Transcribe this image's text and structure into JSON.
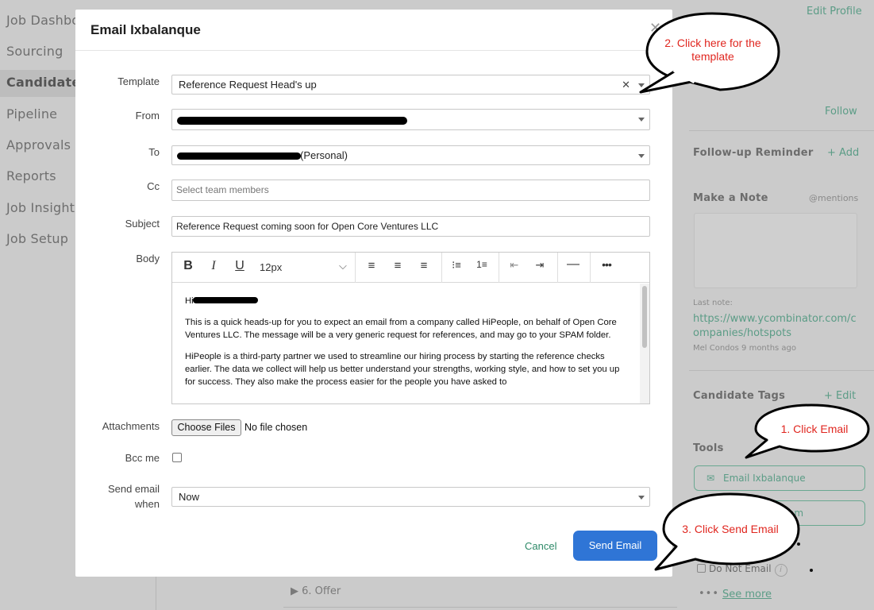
{
  "nav": {
    "items": [
      "Job Dashbo",
      "Sourcing",
      "Candidates",
      "Pipeline",
      "Approvals",
      "Reports",
      "Job Insights",
      "Job Setup"
    ]
  },
  "background": {
    "offer_label": "6. Offer"
  },
  "right_panel": {
    "edit_profile": "Edit Profile",
    "follow": "Follow",
    "followup_reminder": "Follow-up Reminder",
    "add": "+ Add",
    "make_note": "Make a Note",
    "mentions": "@mentions",
    "last_note_label": "Last note:",
    "last_note_link_line1": "https://www.ycombinator.com/c",
    "last_note_link_line2": "ompanies/hotspots",
    "last_note_meta": "Mel Condos 9 months ago",
    "candidate_tags": "Candidate Tags",
    "edit": "+ Edit",
    "tools": "Tools",
    "email_button": "Email Ixbalanque",
    "team_button_fragment": "am",
    "do_not_email": "Do Not Email",
    "see_more": "See more"
  },
  "modal": {
    "title": "Email Ixbalanque",
    "labels": {
      "template": "Template",
      "from": "From",
      "to": "To",
      "cc": "Cc",
      "subject": "Subject",
      "body": "Body",
      "attachments": "Attachments",
      "bcc": "Bcc me",
      "send_when_1": "Send email",
      "send_when_2": "when"
    },
    "template_value": "Reference Request Head's up",
    "to_value_suffix": "(Personal)",
    "cc_placeholder": "Select team members",
    "subject_value": "Reference Request coming soon for Open Core Ventures LLC",
    "font_size": "12px",
    "body": {
      "greeting": "Hi",
      "p1": "This is a quick heads-up for you to expect an email from a company called HiPeople, on behalf of Open Core Ventures LLC. The message will be a very generic request for references, and may go to your SPAM folder.",
      "p2": "HiPeople is a third-party partner we used to streamline our hiring process by starting the reference checks earlier. The data we collect will help us better understand your strengths, working style, and how to set you up for success. They also make the process easier for the people you have asked to"
    },
    "choose_files": "Choose Files",
    "no_file": "No file chosen",
    "send_when_value": "Now",
    "cancel": "Cancel",
    "send": "Send Email"
  },
  "callouts": {
    "template": "2. Click here for the template",
    "email": "1. Click Email",
    "send": "3. Click Send Email",
    "text_color": "#e0261f"
  }
}
